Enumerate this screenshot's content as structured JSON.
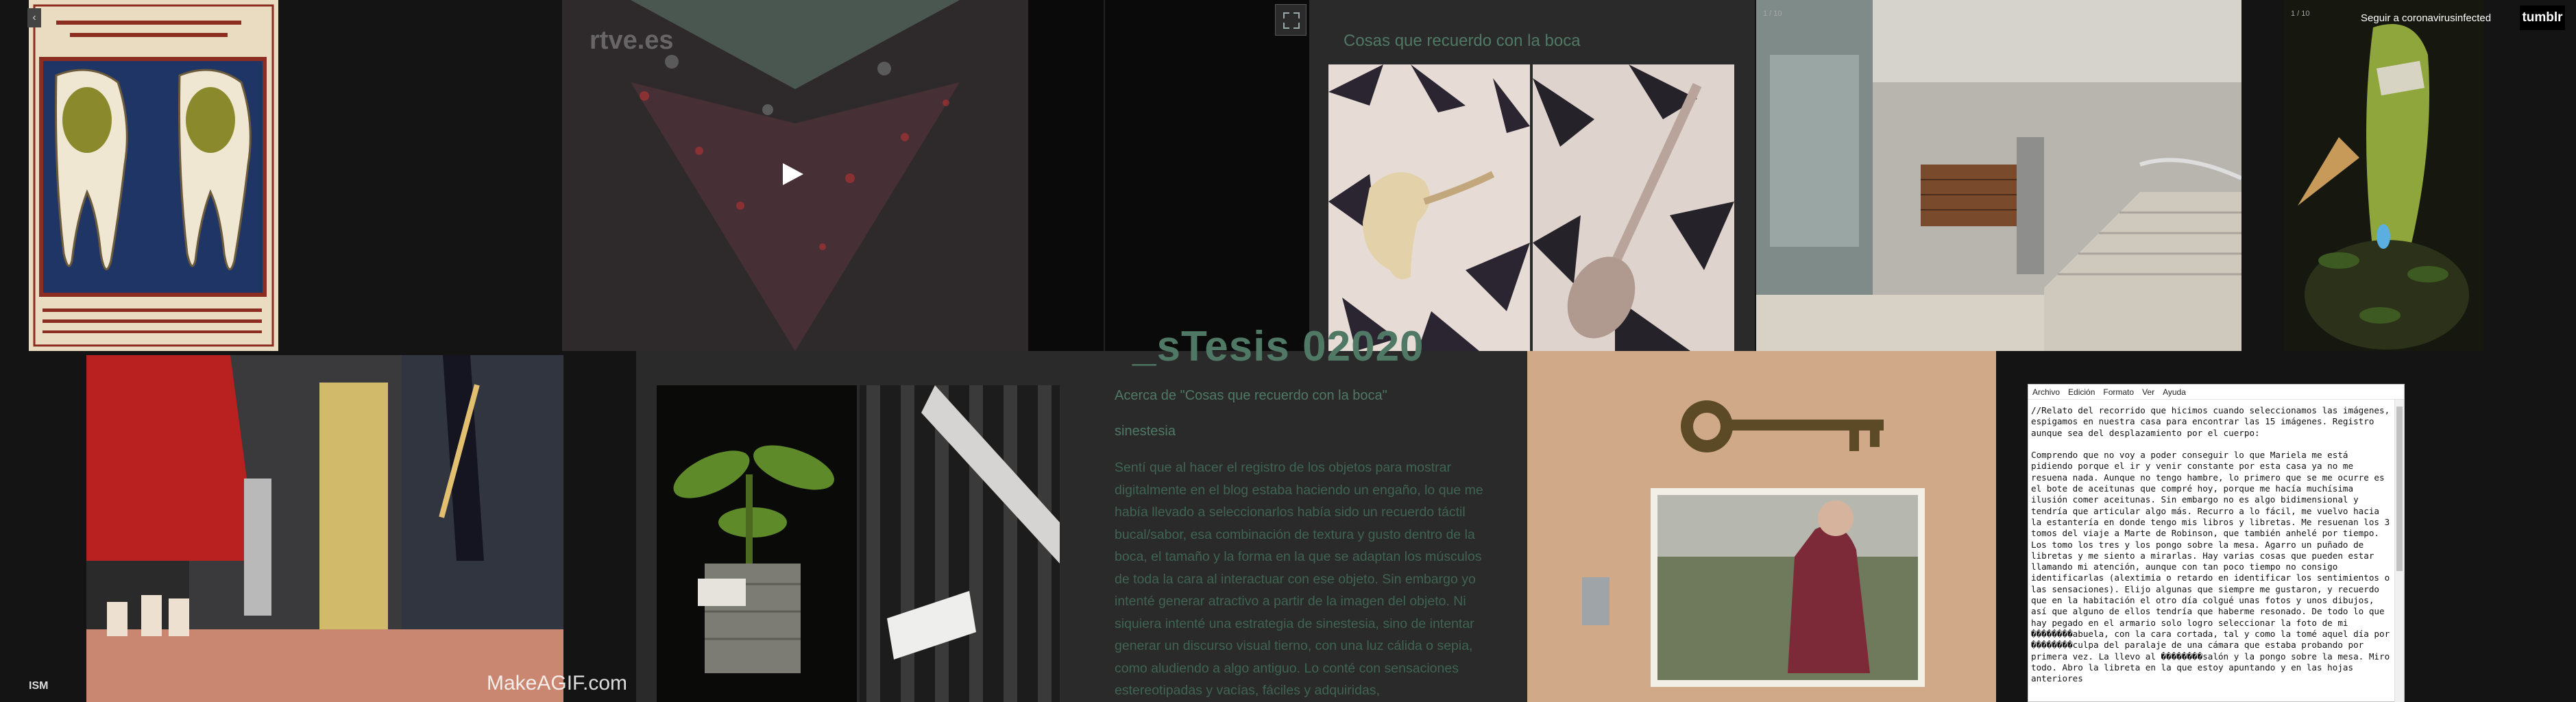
{
  "header": {
    "follow_label": "Seguir a coronavirusinfected",
    "logo_text": "tumblr"
  },
  "blog": {
    "title": "_sTesis 02020",
    "post_link": "Acerca de \"Cosas que recuerdo con la boca\"",
    "tag": "sinestesia",
    "body": "Sentí que al hacer el registro de los objetos para mostrar digitalmente en el blog estaba haciendo un engaño, lo que me había llevado a seleccionarlos había sido un recuerdo táctil bucal/sabor, esa combinación de textura y gusto dentro de la boca, el tamaño y la forma en la que se adaptan los músculos de toda la cara al interactuar con ese objeto. Sin embargo yo intenté generar atractivo a partir de la imagen del objeto. Ni siquiera intenté una estrategia de sinestesia, sino de intentar generar un discurso visual tierno, con una luz cálida o sepia, como aludiendo a algo antiguo. Lo conté con sensaciones estereotipadas y vacías, fáciles y adquiridas,"
  },
  "post": {
    "heading": "Cosas que recuerdo con la boca"
  },
  "badges": {
    "photoset_a": "1 / 10",
    "photoset_b": "1 / 10"
  },
  "video": {
    "watermark": "rtve.es",
    "gif_watermark": "MakeAGIF.com",
    "corner_logo": "ISM"
  },
  "notepad": {
    "menu": [
      "Archivo",
      "Edición",
      "Formato",
      "Ver",
      "Ayuda"
    ],
    "text": "//Relato del recorrido que hicimos cuando seleccionamos las imágenes, espigamos en nuestra casa para encontrar las 15 imágenes. Registro aunque sea del desplazamiento por el cuerpo:\n\nComprendo que no voy a poder conseguir lo que Mariela me está pidiendo porque el ir y venir constante por esta casa ya no me resuena nada. Aunque no tengo hambre, lo primero que se me ocurre es el bote de aceitunas que compré hoy, porque me hacía muchísima ilusión comer aceitunas. Sin embargo no es algo bidimensional y tendría que articular algo más. Recurro a lo fácil, me vuelvo hacia la estantería en donde tengo mis libros y libretas. Me resuenan los 3 tomos del viaje a Marte de Robinson, que también anhelé por tiempo. Los tomo los tres y los pongo sobre la mesa. Agarro un puñado de libretas y me siento a mirarlas. Hay varias cosas que pueden estar llamando mi atención, aunque con tan poco tiempo no consigo identificarlas (alextimia o retardo en identificar los sentimientos o las sensaciones). Elijo algunas que siempre me gustaron, y recuerdo que en la habitación el otro día colgué unas fotos y unos dibujos, así que alguno de ellos tendría que haberme resonado. De todo lo que hay pegado en el armario solo logro seleccionar la foto de mi ��������abuela, con la cara cortada, tal y como la tomé aquel día por ��������culpa del paralaje de una cámara que estaba probando por primera vez. La llevo al ��������salón y la pongo sobre la mesa. Miro todo. Abro la libreta en la que estoy apuntando y en las hojas anteriores"
  }
}
